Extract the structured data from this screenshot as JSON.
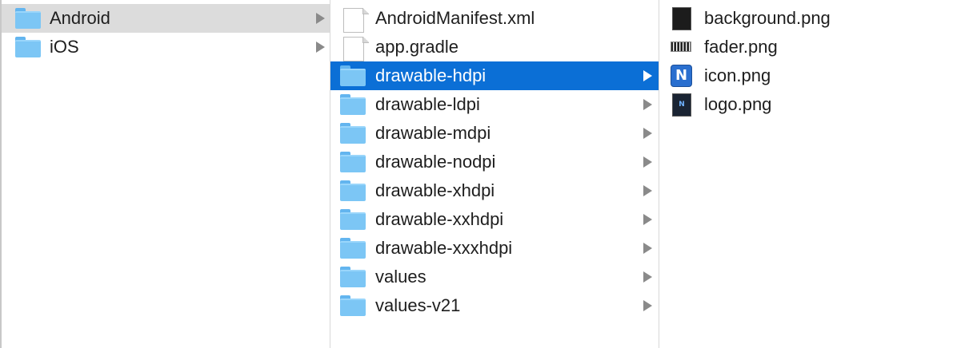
{
  "columns": [
    {
      "items": [
        {
          "label": "Android",
          "kind": "folder",
          "has_children": true,
          "selected": "inactive"
        },
        {
          "label": "iOS",
          "kind": "folder",
          "has_children": true,
          "selected": "none"
        }
      ]
    },
    {
      "items": [
        {
          "label": "AndroidManifest.xml",
          "kind": "document",
          "has_children": false,
          "selected": "none"
        },
        {
          "label": "app.gradle",
          "kind": "document",
          "has_children": false,
          "selected": "none"
        },
        {
          "label": "drawable-hdpi",
          "kind": "folder",
          "has_children": true,
          "selected": "active"
        },
        {
          "label": "drawable-ldpi",
          "kind": "folder",
          "has_children": true,
          "selected": "none"
        },
        {
          "label": "drawable-mdpi",
          "kind": "folder",
          "has_children": true,
          "selected": "none"
        },
        {
          "label": "drawable-nodpi",
          "kind": "folder",
          "has_children": true,
          "selected": "none"
        },
        {
          "label": "drawable-xhdpi",
          "kind": "folder",
          "has_children": true,
          "selected": "none"
        },
        {
          "label": "drawable-xxhdpi",
          "kind": "folder",
          "has_children": true,
          "selected": "none"
        },
        {
          "label": "drawable-xxxhdpi",
          "kind": "folder",
          "has_children": true,
          "selected": "none"
        },
        {
          "label": "values",
          "kind": "folder",
          "has_children": true,
          "selected": "none"
        },
        {
          "label": "values-v21",
          "kind": "folder",
          "has_children": true,
          "selected": "none"
        }
      ]
    },
    {
      "items": [
        {
          "label": "background.png",
          "kind": "image",
          "icon": "black-image-thumbnail-icon"
        },
        {
          "label": "fader.png",
          "kind": "image",
          "icon": "striped-image-thumbnail-icon"
        },
        {
          "label": "icon.png",
          "kind": "image",
          "icon": "app-icon-thumbnail-icon"
        },
        {
          "label": "logo.png",
          "kind": "image",
          "icon": "logo-thumbnail-icon"
        }
      ]
    }
  ],
  "colors": {
    "selection_active": "#0b6fd6",
    "selection_inactive": "#dcdcdc",
    "folder": "#7cc6f5"
  }
}
